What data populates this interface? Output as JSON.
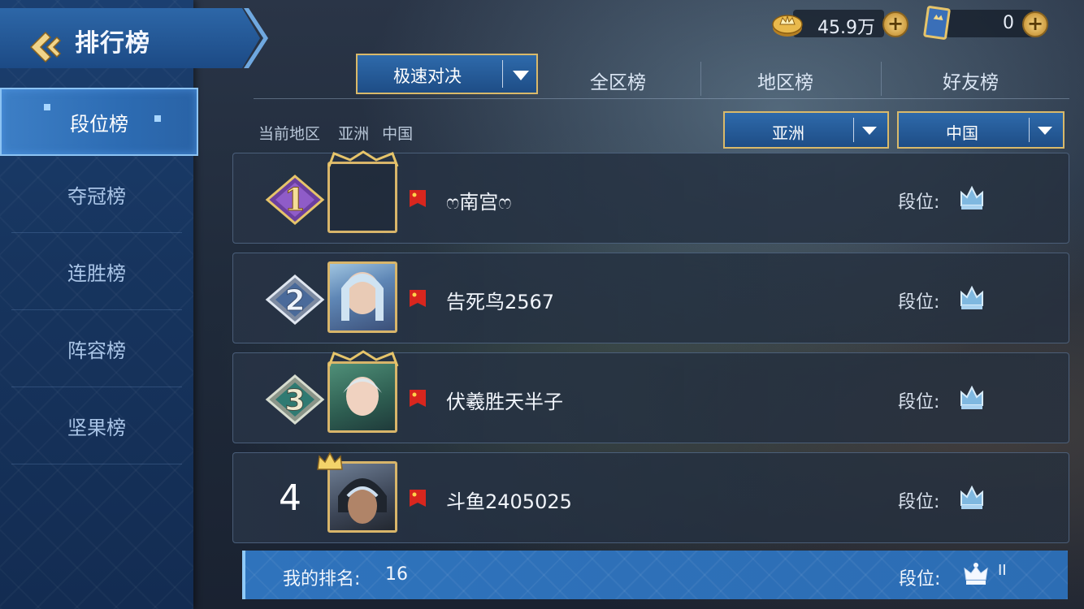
{
  "header": {
    "title": "排行榜",
    "back_icon": "back-arrow-icon"
  },
  "sidebar": {
    "items": [
      {
        "label": "段位榜",
        "active": true
      },
      {
        "label": "夺冠榜",
        "active": false
      },
      {
        "label": "连胜榜",
        "active": false
      },
      {
        "label": "阵容榜",
        "active": false
      },
      {
        "label": "坚果榜",
        "active": false
      }
    ]
  },
  "currency": {
    "gold": {
      "value": "45.9万",
      "icon": "gold-coin-icon"
    },
    "tickets": {
      "value": "0",
      "icon": "ticket-icon"
    }
  },
  "mode_select": {
    "value": "极速对决"
  },
  "tabs": [
    {
      "label": "全区榜"
    },
    {
      "label": "地区榜"
    },
    {
      "label": "好友榜"
    }
  ],
  "region": {
    "label": "当前地区",
    "continent": "亚洲",
    "country": "中国",
    "continent_select": "亚洲",
    "country_select": "中国"
  },
  "rows": [
    {
      "rank": "1",
      "name": "ෆ南宫ෆ",
      "tier_label": "段位:",
      "tier_icon": "crown-tier-icon",
      "flag_icon": "china-flag-icon"
    },
    {
      "rank": "2",
      "name": "告死鸟2567",
      "tier_label": "段位:",
      "tier_icon": "crown-tier-icon",
      "flag_icon": "china-flag-icon"
    },
    {
      "rank": "3",
      "name": "伏羲胜天半子",
      "tier_label": "段位:",
      "tier_icon": "crown-tier-icon",
      "flag_icon": "china-flag-icon"
    },
    {
      "rank": "4",
      "name": "斗鱼2405025",
      "tier_label": "段位:",
      "tier_icon": "crown-tier-icon",
      "flag_icon": "china-flag-icon"
    }
  ],
  "my_rank": {
    "label": "我的排名:",
    "value": "16",
    "tier_label": "段位:",
    "tier_level": "II"
  },
  "colors": {
    "gold_border": "#d9b96a",
    "sidebar_bg": "#17355f",
    "active_blue": "#3d7fc6"
  }
}
